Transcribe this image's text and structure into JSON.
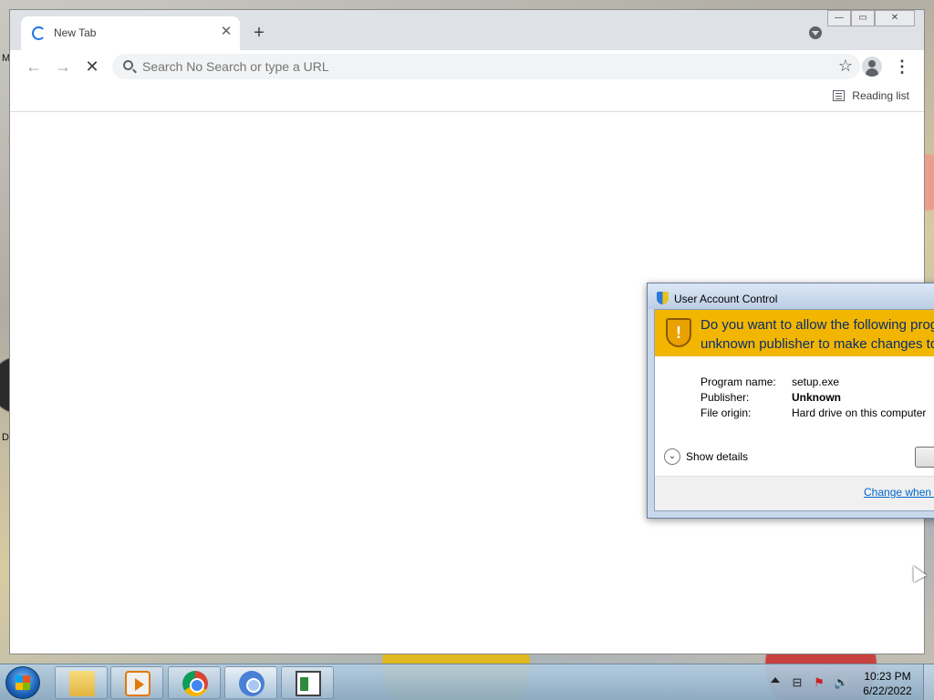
{
  "desktop": {
    "label_m": "M",
    "label_d": "D"
  },
  "browser": {
    "tab": {
      "title": "New Tab",
      "close": "✕"
    },
    "new_tab": "+",
    "window_controls": {
      "minimize": "—",
      "maximize": "▭",
      "close": "✕"
    },
    "nav": {
      "back": "←",
      "forward": "→",
      "stop": "✕"
    },
    "omnibox": {
      "placeholder": "Search No Search or type a URL"
    },
    "bookmark_star": "☆",
    "menu": "⋮",
    "reading_list": "Reading list"
  },
  "uac": {
    "title": "User Account Control",
    "question_line1": "Do you want to allow the following program from an",
    "question_line2": "unknown publisher to make changes to this computer?",
    "shield_mark": "!",
    "details": [
      {
        "key": "Program name:",
        "value": "setup.exe"
      },
      {
        "key": "Publisher:",
        "value": "Unknown"
      },
      {
        "key": "File origin:",
        "value": "Hard drive on this computer"
      }
    ],
    "show_details": "Show details",
    "chevron": "⌄",
    "change_link": "Change when these notifications appear"
  },
  "taskbar": {
    "clock_time": "10:23 PM",
    "clock_date": "6/22/2022",
    "tray": {
      "network": "⊟",
      "flag": "⚑",
      "volume": "🔊"
    }
  },
  "colors": {
    "uac_banner": "#f2b600",
    "link": "#0066cc",
    "chrome_tab_bg": "#dee1e6"
  }
}
